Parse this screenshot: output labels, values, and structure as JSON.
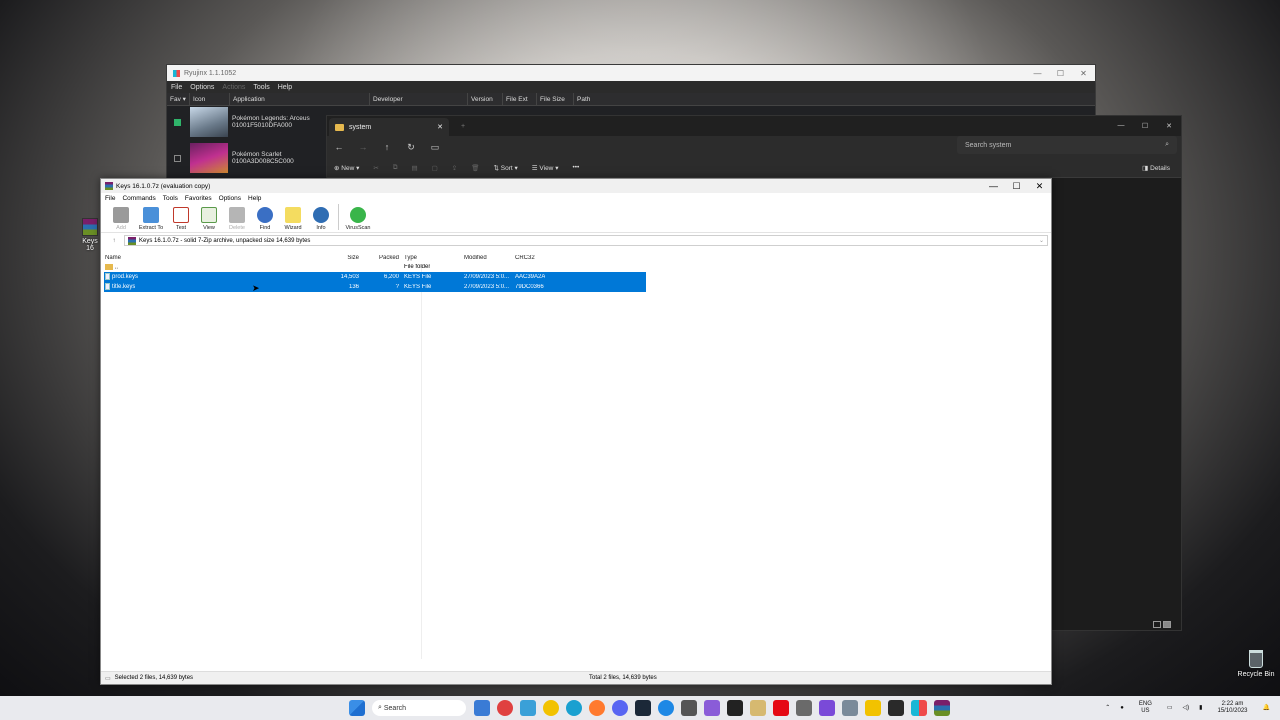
{
  "desktop": {
    "left_icon_label": "Keys 16",
    "recycle_label": "Recycle Bin"
  },
  "ryujinx": {
    "title": "Ryujinx 1.1.1052",
    "menu": [
      "File",
      "Options",
      "Actions",
      "Tools",
      "Help"
    ],
    "columns": [
      "Fav",
      "Icon",
      "Application",
      "Developer",
      "Version",
      "File Ext",
      "File Size",
      "Path"
    ],
    "games": [
      {
        "name": "Pokémon Legends: Arceus",
        "id": "01001F5010DFA000",
        "fav": true
      },
      {
        "name": "Pokémon Scarlet",
        "id": "0100A3D008C5C000",
        "fav": false
      }
    ],
    "fav_sort_glyph": "▾"
  },
  "explorer": {
    "tab_title": "system",
    "search_placeholder": "Search system",
    "commands": [
      "New",
      "Sort",
      "View"
    ],
    "details_label": "Details"
  },
  "winrar": {
    "title": "Keys 16.1.0.7z (evaluation copy)",
    "menu": [
      "File",
      "Commands",
      "Tools",
      "Favorites",
      "Options",
      "Help"
    ],
    "toolbar": [
      {
        "label": "Add",
        "icon": "add-archive-icon",
        "enabled": false,
        "color": "#7a7a7a"
      },
      {
        "label": "Extract To",
        "icon": "extract-folder-icon",
        "enabled": true,
        "color": "#4a90d9"
      },
      {
        "label": "Test",
        "icon": "test-icon",
        "enabled": true,
        "color": "#c0392b"
      },
      {
        "label": "View",
        "icon": "view-icon",
        "enabled": true,
        "color": "#5a9a4a"
      },
      {
        "label": "Delete",
        "icon": "delete-icon",
        "enabled": false,
        "color": "#8a8a8a"
      },
      {
        "label": "Find",
        "icon": "find-icon",
        "enabled": true,
        "color": "#3a6fc4"
      },
      {
        "label": "Wizard",
        "icon": "wizard-icon",
        "enabled": true,
        "color": "#d4b020"
      },
      {
        "label": "Info",
        "icon": "info-icon",
        "enabled": true,
        "color": "#2f6db3"
      }
    ],
    "virus_scan": "VirusScan",
    "path": "Keys 16.1.0.7z - solid 7-Zip archive, unpacked size 14,639 bytes",
    "columns": {
      "name": "Name",
      "size": "Size",
      "packed": "Packed",
      "type": "Type",
      "modified": "Modified",
      "crc": "CRC32"
    },
    "parent_row": {
      "name": "..",
      "type": "File folder"
    },
    "files": [
      {
        "name": "prod.keys",
        "size": "14,503",
        "packed": "6,200",
        "type": "KEYS File",
        "modified": "27/09/2023 5:0...",
        "crc": "AAC39A2A"
      },
      {
        "name": "title.keys",
        "size": "136",
        "packed": "?",
        "type": "KEYS File",
        "modified": "27/09/2023 5:0...",
        "crc": "79DC0366"
      }
    ],
    "status_left": "Selected 2 files, 14,639 bytes",
    "status_right": "Total 2 files, 14,639 bytes"
  },
  "taskbar": {
    "search_label": "Search",
    "lang_top": "ENG",
    "lang_bottom": "US",
    "time": "2:22 am",
    "date": "15/10/2023"
  }
}
